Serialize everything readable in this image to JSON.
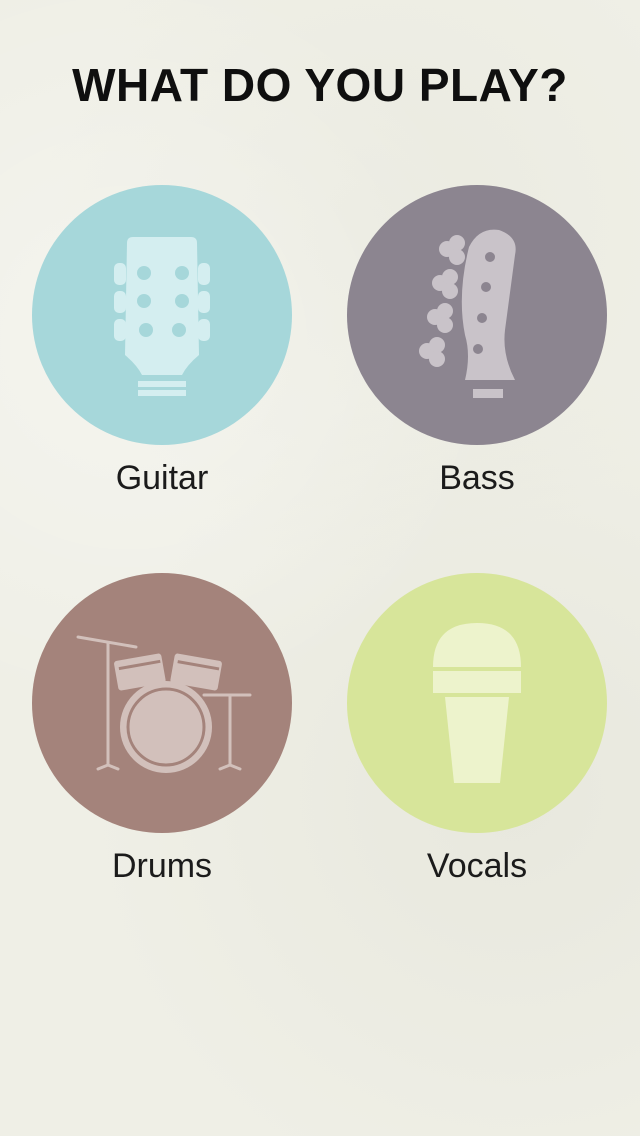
{
  "header": {
    "title": "WHAT DO YOU PLAY?"
  },
  "instruments": [
    {
      "label": "Guitar",
      "icon": "guitar-headstock-icon",
      "color": "#a6d7da"
    },
    {
      "label": "Bass",
      "icon": "bass-headstock-icon",
      "color": "#8c8590"
    },
    {
      "label": "Drums",
      "icon": "drum-kit-icon",
      "color": "#a4837b"
    },
    {
      "label": "Vocals",
      "icon": "microphone-icon",
      "color": "#d7e59a"
    }
  ],
  "colors": {
    "background": "#efefe6",
    "text": "#0f0f0f"
  }
}
